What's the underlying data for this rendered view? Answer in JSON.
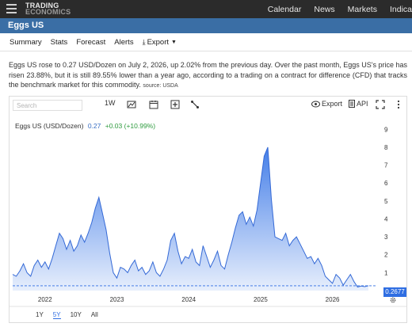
{
  "nav": {
    "logo_line1": "TRADING",
    "logo_line2": "ECONOMICS",
    "links": [
      "Calendar",
      "News",
      "Markets",
      "Indica"
    ]
  },
  "page": {
    "title": "Eggs US"
  },
  "tabs": [
    "Summary",
    "Stats",
    "Forecast",
    "Alerts",
    "Export"
  ],
  "description": {
    "text": "Eggs US rose to 0.27 USD/Dozen on July 2, 2026, up 2.02% from the previous day. Over the past month, Eggs US's price has risen 23.88%, but it is still 89.55% lower than a year ago, according to a trading on a contract for difference (CFD) that tracks the benchmark market for this commodity.",
    "source": "source: USDA"
  },
  "toolbar": {
    "search_placeholder": "Search",
    "interval": "1W",
    "export_label": "Export",
    "api_label": "API"
  },
  "legend": {
    "name": "Eggs US (USD/Dozen)",
    "value": "0.27",
    "change": "+0.03 (+10.99%)"
  },
  "price_label": "0.2677",
  "ranges": [
    "1Y",
    "5Y",
    "10Y",
    "All"
  ],
  "active_range": "5Y",
  "colors": {
    "accent": "#2f6ee2",
    "nav_bg": "#2b2b2b",
    "title_band": "#3a6ea5",
    "positive": "#2e9b3e"
  },
  "chart_data": {
    "type": "area",
    "series": [
      {
        "name": "Eggs US (USD/Dozen)",
        "x": [
          2021.55,
          2021.6,
          2021.65,
          2021.7,
          2021.75,
          2021.8,
          2021.85,
          2021.9,
          2021.95,
          2022.0,
          2022.05,
          2022.1,
          2022.15,
          2022.2,
          2022.25,
          2022.3,
          2022.35,
          2022.4,
          2022.45,
          2022.5,
          2022.55,
          2022.6,
          2022.65,
          2022.7,
          2022.75,
          2022.8,
          2022.85,
          2022.9,
          2022.95,
          2023.0,
          2023.05,
          2023.1,
          2023.15,
          2023.2,
          2023.25,
          2023.3,
          2023.35,
          2023.4,
          2023.45,
          2023.5,
          2023.55,
          2023.6,
          2023.65,
          2023.7,
          2023.75,
          2023.8,
          2023.85,
          2023.9,
          2023.95,
          2024.0,
          2024.05,
          2024.1,
          2024.15,
          2024.2,
          2024.25,
          2024.3,
          2024.35,
          2024.4,
          2024.45,
          2024.5,
          2024.55,
          2024.6,
          2024.65,
          2024.7,
          2024.75,
          2024.8,
          2024.85,
          2024.9,
          2024.95,
          2025.0,
          2025.05,
          2025.1,
          2025.15,
          2025.2,
          2025.25,
          2025.3,
          2025.35,
          2025.4,
          2025.45,
          2025.5,
          2025.55,
          2025.6,
          2025.65,
          2025.7,
          2025.75,
          2025.8,
          2025.85,
          2025.9,
          2025.95,
          2026.0,
          2026.05,
          2026.1,
          2026.15,
          2026.2,
          2026.25,
          2026.3,
          2026.35,
          2026.4,
          2026.45,
          2026.5
        ],
        "values": [
          0.9,
          0.8,
          1.1,
          1.5,
          1.0,
          0.8,
          1.4,
          1.7,
          1.3,
          1.6,
          1.2,
          1.8,
          2.5,
          3.2,
          2.9,
          2.3,
          2.8,
          2.2,
          2.5,
          3.1,
          2.7,
          3.2,
          3.8,
          4.6,
          5.2,
          4.3,
          3.4,
          2.1,
          1.0,
          0.7,
          1.3,
          1.2,
          1.0,
          1.4,
          1.7,
          1.1,
          1.3,
          0.9,
          1.1,
          1.6,
          1.0,
          0.8,
          1.2,
          1.7,
          2.8,
          3.2,
          2.2,
          1.5,
          1.9,
          1.8,
          2.3,
          1.6,
          1.4,
          2.5,
          1.9,
          1.3,
          1.7,
          2.2,
          1.4,
          1.2,
          2.0,
          2.7,
          3.5,
          4.2,
          4.4,
          3.7,
          4.1,
          3.6,
          4.5,
          6.0,
          7.5,
          8.0,
          5.1,
          3.0,
          2.9,
          2.8,
          3.2,
          2.5,
          2.8,
          3.0,
          2.6,
          2.2,
          1.8,
          1.9,
          1.5,
          1.8,
          1.4,
          0.8,
          0.6,
          0.4,
          0.9,
          0.7,
          0.3,
          0.6,
          0.9,
          0.5,
          0.2,
          0.25,
          0.22,
          0.27
        ]
      }
    ],
    "x_ticks": [
      "2022",
      "2023",
      "2024",
      "2025",
      "2026"
    ],
    "y_ticks": [
      1,
      2,
      3,
      4,
      5,
      6,
      7,
      8,
      9
    ],
    "xlim": [
      2021.55,
      2026.6
    ],
    "ylim": [
      0,
      9.5
    ],
    "grid": false,
    "last_value_marker": 0.2677
  }
}
